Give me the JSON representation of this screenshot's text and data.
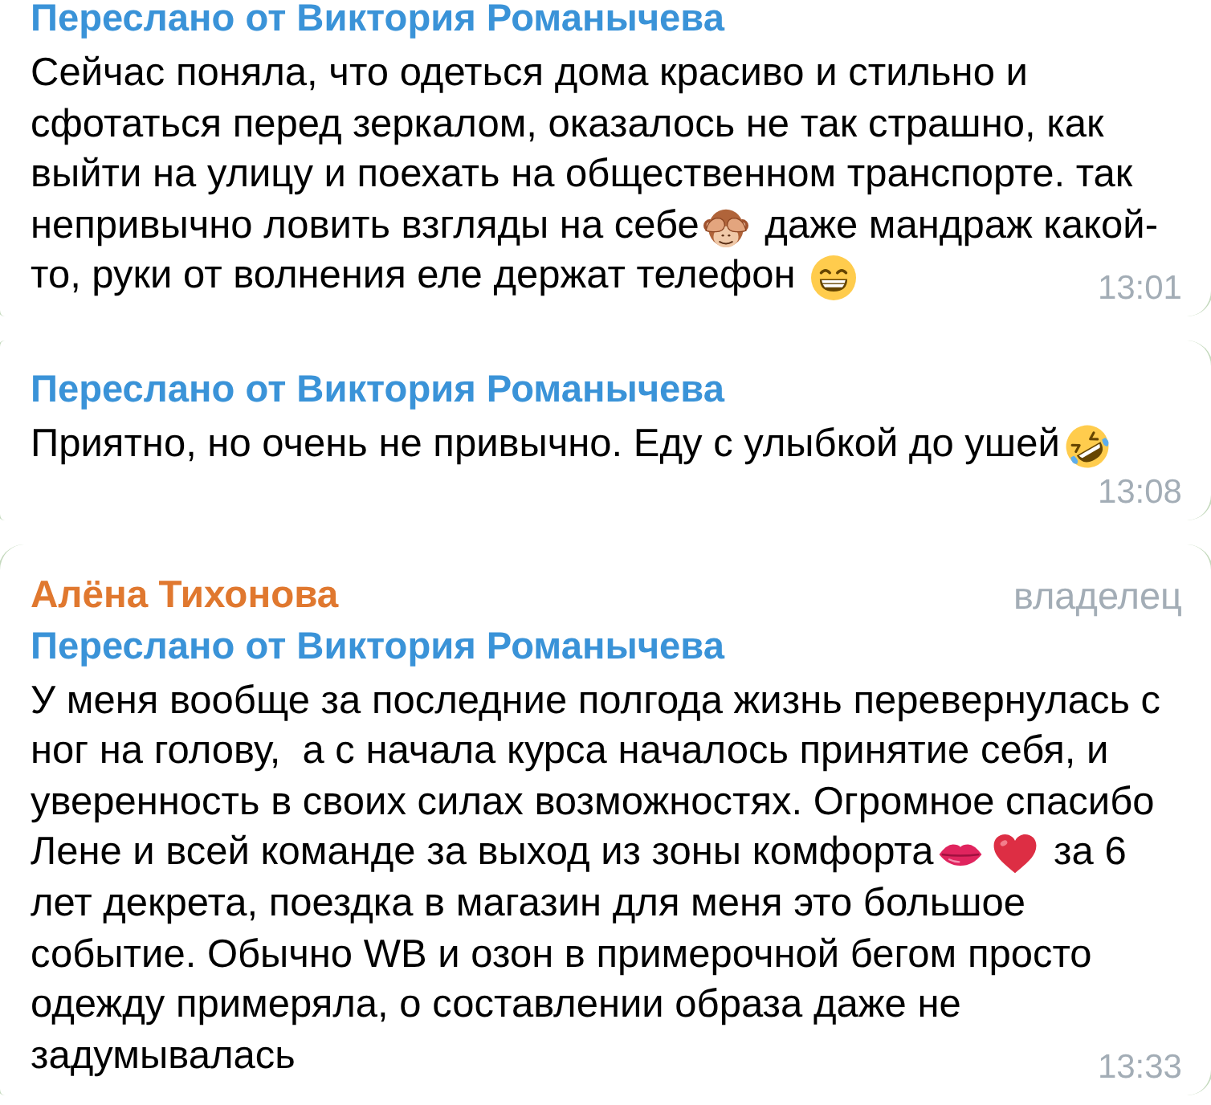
{
  "messages": [
    {
      "forwarded": "Переслано от Виктория Романычева",
      "body": [
        {
          "kind": "text",
          "text": "Сейчас поняла, что одеться дома красиво и стильно и сфотаться перед зеркалом, оказалось не так страшно, как выйти на улицу и поехать на общественном транспорте. так непривычно ловить взгляды на себе"
        },
        {
          "kind": "monkey"
        },
        {
          "kind": "text",
          "text": " даже мандраж какой-то, руки от волнения еле держат телефон "
        },
        {
          "kind": "grin"
        }
      ],
      "time": "13:01"
    },
    {
      "forwarded": "Переслано от Виктория Романычева",
      "body": [
        {
          "kind": "text",
          "text": "Приятно, но очень не привычно. Еду с улыбкой до ушей"
        },
        {
          "kind": "rofl"
        }
      ],
      "time": "13:08"
    },
    {
      "author": "Алёна Тихонова",
      "role": "владелец",
      "forwarded": "Переслано от Виктория Романычева",
      "body": [
        {
          "kind": "text",
          "text": "У меня вообще за последние полгода жизнь перевернулась с ног на голову,  а с начала курса началось принятие себя, и уверенность в своих силах возможностях. Огромное спасибо Лене и всей команде за выход из зоны комфорта"
        },
        {
          "kind": "kiss"
        },
        {
          "kind": "heart"
        },
        {
          "kind": "text",
          "text": " за 6 лет декрета, поездка в магазин для меня это большое событие. Обычно WB и озон в примерочной бегом просто одежду примеряла, о составлении образа даже не задумывалась"
        }
      ],
      "time": "13:33"
    }
  ]
}
